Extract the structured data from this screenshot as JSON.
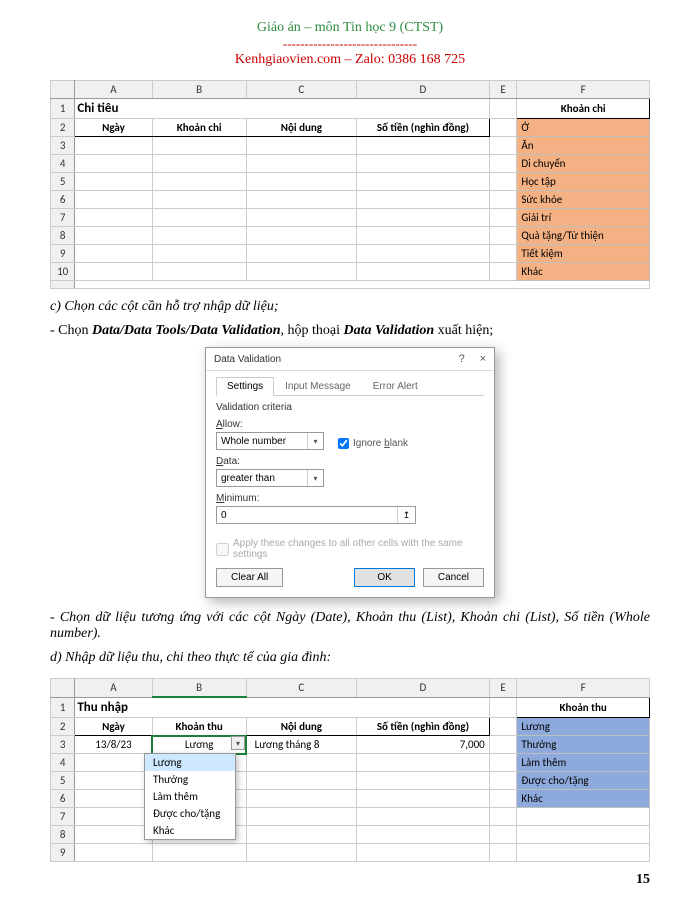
{
  "header": {
    "title": "Giáo án – môn Tin học 9 (CTST)",
    "dashes": "-------------------------------",
    "subtitle": "Kenhgiaovien.com – Zalo: 0386 168 725"
  },
  "table1": {
    "cols": [
      "A",
      "B",
      "C",
      "D",
      "E",
      "F"
    ],
    "title_cell": "Chi tiêu",
    "khoan_chi_header": "Khoản chi",
    "row2": [
      "Ngày",
      "Khoản chi",
      "Nội dung",
      "Số tiền (nghìn đồng)"
    ],
    "f_items": [
      "Ở",
      "Ăn",
      "Di chuyển",
      "Học tập",
      "Sức khỏe",
      "Giải trí",
      "Quà tặng/Từ thiện",
      "Tiết kiệm",
      "Khác"
    ]
  },
  "body1": "c) Chọn các cột cần hỗ trợ nhập dữ liệu;",
  "body2_pre": "- Chọn ",
  "body2_bold1": "Data/Data Tools/Data Validation",
  "body2_mid": ", hộp thoại ",
  "body2_bold2": "Data Validation",
  "body2_post": " xuất hiện;",
  "dialog": {
    "title": "Data Validation",
    "help": "?",
    "close": "×",
    "tabs": [
      "Settings",
      "Input Message",
      "Error Alert"
    ],
    "criteria": "Validation criteria",
    "allow_label": "Allow:",
    "allow_value": "Whole number",
    "ignore_blank": "Ignore blank",
    "data_label": "Data:",
    "data_value": "greater than",
    "min_label": "Minimum:",
    "min_value": "0",
    "apply_label": "Apply these changes to all other cells with the same settings",
    "clear": "Clear All",
    "ok": "OK",
    "cancel": "Cancel"
  },
  "body3": "- Chọn dữ liệu tương ứng với các cột Ngày (Date), Khoản thu (List), Khoản chi (List), Số tiền (Whole number).",
  "body4": "d) Nhập dữ liệu thu, chi theo thực tế của gia đình:",
  "table2": {
    "cols": [
      "A",
      "B",
      "C",
      "D",
      "E",
      "F"
    ],
    "title_cell": "Thu nhập",
    "khoan_thu_header": "Khoản thu",
    "row2": [
      "Ngày",
      "Khoản thu",
      "Nội dung",
      "Số tiền (nghìn đồng)"
    ],
    "row3": {
      "date": "13/8/23",
      "b": "Lương",
      "c": "Lương tháng 8",
      "d": "7,000"
    },
    "dropdown": [
      "Lương",
      "Thưởng",
      "Làm thêm",
      "Được cho/tặng",
      "Khác"
    ],
    "f_items": [
      "Lương",
      "Thưởng",
      "Làm thêm",
      "Được cho/tặng",
      "Khác"
    ]
  },
  "page": "15"
}
